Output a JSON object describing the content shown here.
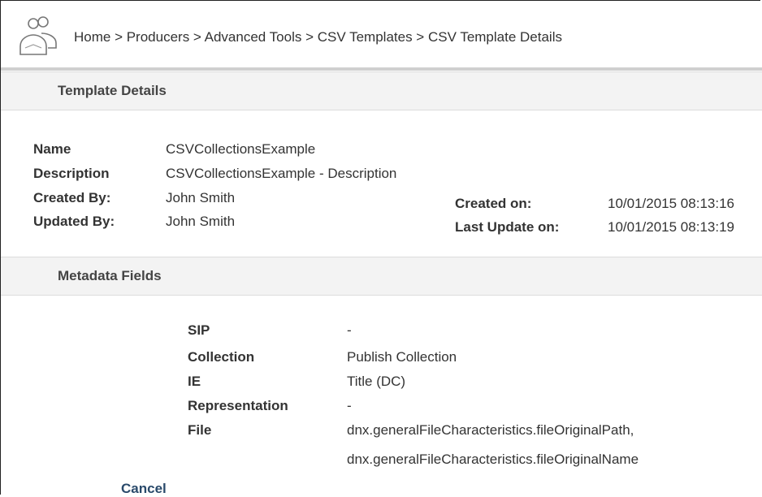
{
  "breadcrumb": "Home > Producers > Advanced Tools > CSV Templates > CSV Template Details",
  "template_details": {
    "title": "Template Details",
    "name_label": "Name",
    "name_value": "CSVCollectionsExample",
    "description_label": "Description",
    "description_value": "CSVCollectionsExample - Description",
    "created_by_label": "Created By:",
    "created_by_value": "John Smith",
    "updated_by_label": "Updated By:",
    "updated_by_value": "John Smith",
    "created_on_label": "Created on:",
    "created_on_value": "10/01/2015 08:13:16",
    "last_update_label": "Last Update on:",
    "last_update_value": "10/01/2015 08:13:19"
  },
  "metadata_fields": {
    "title": "Metadata Fields",
    "sip_label": "SIP",
    "sip_value": "-",
    "collection_label": "Collection",
    "collection_value": "Publish Collection",
    "ie_label": "IE",
    "ie_value": "Title (DC)",
    "representation_label": "Representation",
    "representation_value": "-",
    "file_label": "File",
    "file_value_1": "dnx.generalFileCharacteristics.fileOriginalPath,",
    "file_value_2": "dnx.generalFileCharacteristics.fileOriginalName"
  },
  "actions": {
    "cancel_label": "Cancel"
  },
  "icons": {
    "producers": "users-icon"
  }
}
